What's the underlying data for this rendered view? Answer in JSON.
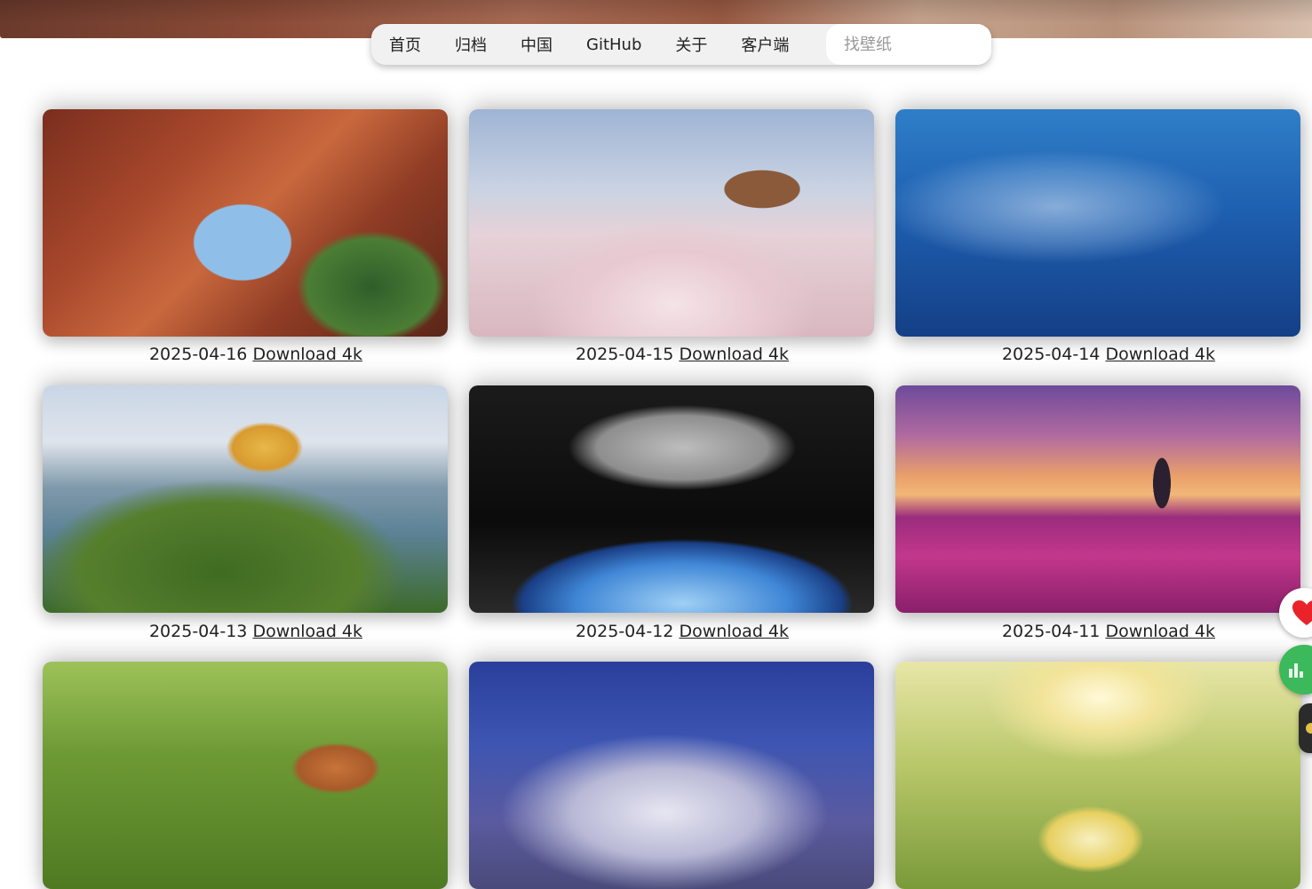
{
  "nav": {
    "items": [
      "首页",
      "归档",
      "中国",
      "GitHub",
      "关于",
      "客户端"
    ],
    "search_placeholder": "找壁纸"
  },
  "gallery": [
    {
      "date": "2025-04-16",
      "link": "Download 4k"
    },
    {
      "date": "2025-04-15",
      "link": "Download 4k"
    },
    {
      "date": "2025-04-14",
      "link": "Download 4k"
    },
    {
      "date": "2025-04-13",
      "link": "Download 4k"
    },
    {
      "date": "2025-04-12",
      "link": "Download 4k"
    },
    {
      "date": "2025-04-11",
      "link": "Download 4k"
    }
  ],
  "colors": {
    "like": "#e8232a",
    "chart": "#3cb95a"
  },
  "icons": {
    "like": "heart-icon",
    "stats": "bar-chart-icon"
  }
}
